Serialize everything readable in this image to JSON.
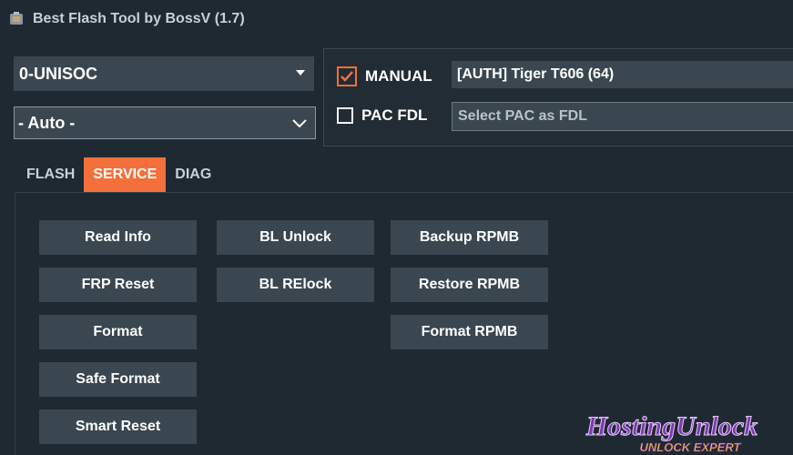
{
  "window": {
    "title": "Best Flash Tool by BossV (1.7)"
  },
  "platform_select": {
    "value": "0-UNISOC"
  },
  "mode_select": {
    "value": "- Auto -"
  },
  "manual": {
    "label": "MANUAL",
    "checked": true,
    "model_value": "[AUTH] Tiger T606 (64)"
  },
  "pac_fdl": {
    "label": "PAC FDL",
    "checked": false,
    "placeholder": "Select PAC as FDL"
  },
  "tabs": [
    {
      "label": "FLASH",
      "active": false
    },
    {
      "label": "SERVICE",
      "active": true
    },
    {
      "label": "DIAG",
      "active": false
    }
  ],
  "service_buttons": {
    "col1": [
      "Read Info",
      "FRP Reset",
      "Format",
      "Safe Format",
      "Smart Reset"
    ],
    "col2": [
      "BL Unlock",
      "BL RElock"
    ],
    "col3": [
      "Backup RPMB",
      "Restore RPMB",
      "Format RPMB"
    ]
  },
  "watermark": {
    "line1": "HostingUnlock",
    "line2": "UNLOCK EXPERT"
  },
  "colors": {
    "background": "#1f2931",
    "control": "#3a4750",
    "accent": "#f36f3b",
    "watermark": "#7a3aa8"
  }
}
